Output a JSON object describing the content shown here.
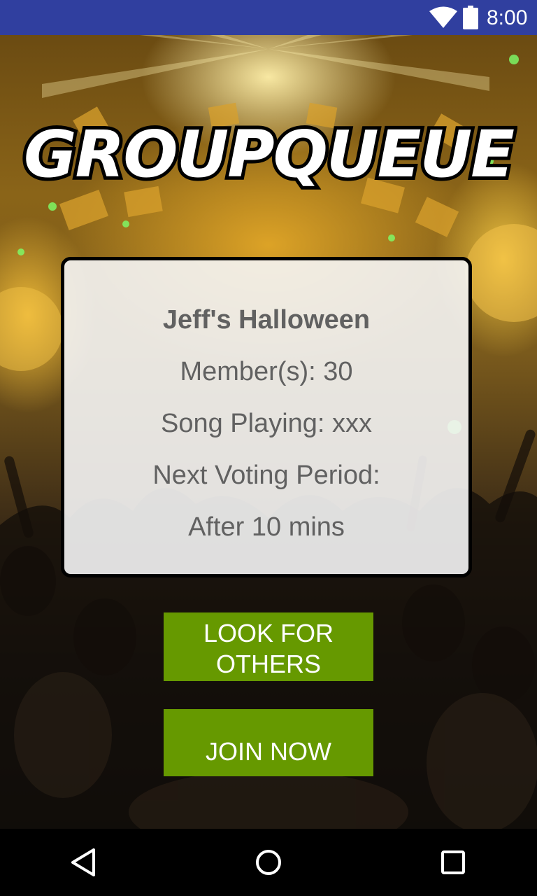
{
  "status_bar": {
    "time": "8:00",
    "icons": [
      "wifi-icon",
      "battery-icon"
    ],
    "background": "#303f9f"
  },
  "app": {
    "logo_text": "GROUPQUEUE"
  },
  "group_card": {
    "name": "Jeff's Halloween",
    "members": "Member(s): 30",
    "song_playing": "Song Playing: xxx",
    "next_voting_label": "Next Voting Period:",
    "next_voting_value": "After 10 mins"
  },
  "buttons": {
    "look_for_others": "LOOK FOR OTHERS",
    "join_now": "JOIN NOW",
    "color": "#669900"
  },
  "nav_bar": {
    "icons": [
      "back-icon",
      "home-icon",
      "recent-apps-icon"
    ]
  }
}
